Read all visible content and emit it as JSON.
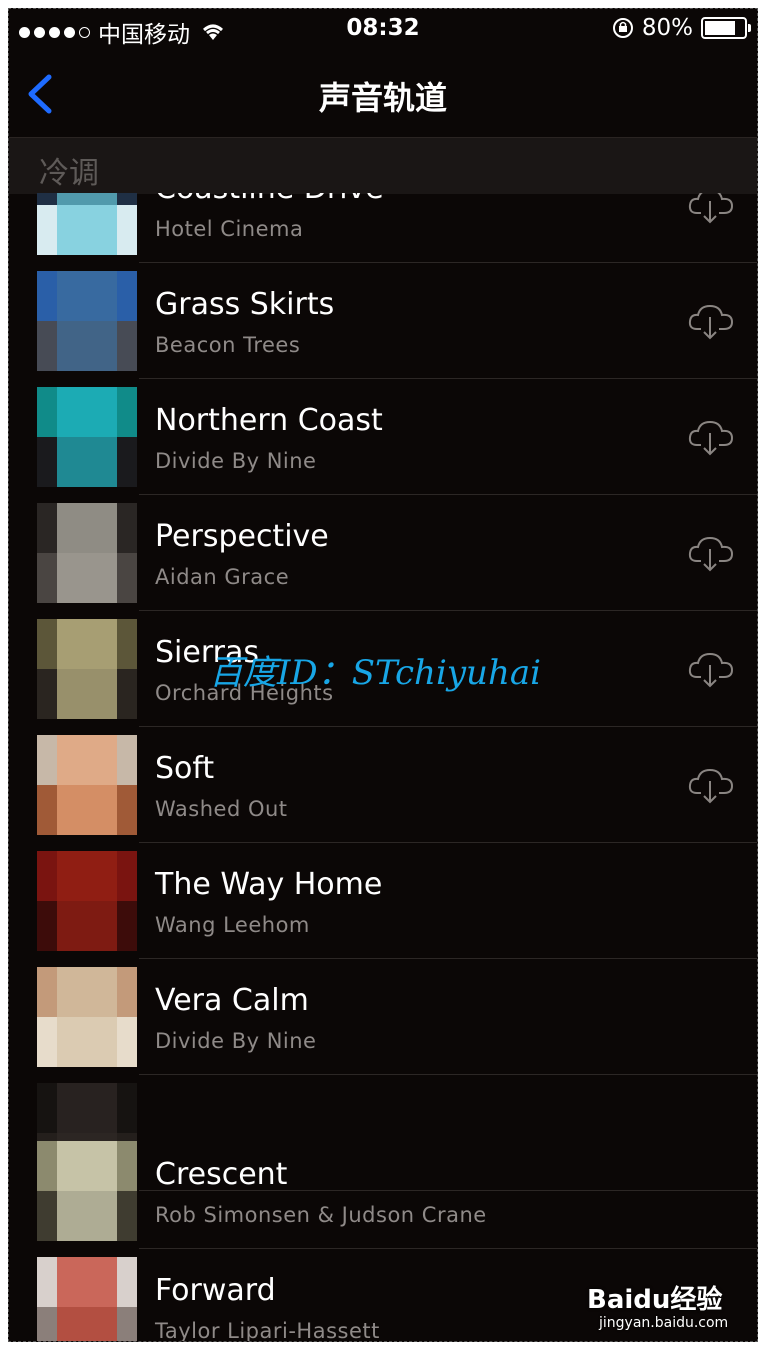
{
  "status_bar": {
    "carrier": "中国移动",
    "time": "08:32",
    "battery": "80%",
    "battery_level": 0.8
  },
  "nav": {
    "title": "声音轨道",
    "back_icon": "chevron-left-icon",
    "accent": "#1e6bff"
  },
  "section": {
    "label": "冷调"
  },
  "tracks": [
    {
      "title": "Coastline Drive",
      "artist": "Hotel Cinema",
      "downloadable": true,
      "art": [
        "#1f2f44",
        "#d8ebf0",
        "#66c7d8"
      ]
    },
    {
      "title": "Grass Skirts",
      "artist": "Beacon Trees",
      "downloadable": true,
      "art": [
        "#2a5fa8",
        "#474b55",
        "#3f6f9c"
      ]
    },
    {
      "title": "Northern Coast",
      "artist": "Divide By Nine",
      "downloadable": true,
      "art": [
        "#108b89",
        "#1a1a1d",
        "#22b9c6"
      ]
    },
    {
      "title": "Perspective",
      "artist": "Aidan Grace",
      "downloadable": true,
      "art": [
        "#2a2624",
        "#4a4542",
        "#bab8ae"
      ]
    },
    {
      "title": "Sierras",
      "artist": "Orchard Heights",
      "downloadable": true,
      "art": [
        "#5c5639",
        "#2a2520",
        "#c7bd8c"
      ]
    },
    {
      "title": "Soft",
      "artist": "Washed Out",
      "downloadable": true,
      "art": [
        "#c7b8a8",
        "#a05a37",
        "#e9a479"
      ]
    },
    {
      "title": "The Way Home",
      "artist": "Wang Leehom",
      "downloadable": false,
      "art": [
        "#7a1410",
        "#3d0c0a",
        "#9a2216"
      ]
    },
    {
      "title": "Vera Calm",
      "artist": "Divide By Nine",
      "downloadable": false,
      "art": [
        "#c39a7a",
        "#e7dccb",
        "#d5c3a6"
      ]
    },
    {
      "title": "",
      "artist": "",
      "downloadable": false,
      "art": [
        "#161311",
        "#241f1c",
        "#302a26"
      ]
    },
    {
      "title": "Crescent",
      "artist": "Rob Simonsen & Judson Crane",
      "downloadable": false,
      "art": [
        "#8c8a6e",
        "#3f3c30",
        "#dedbbf"
      ]
    },
    {
      "title": "Forward",
      "artist": "Taylor Lipari-Hassett",
      "downloadable": false,
      "art": [
        "#d8d0cc",
        "#8b7f7a",
        "#c43a2a"
      ]
    }
  ],
  "watermark": "百度ID：STchiyuhai",
  "baidu_logo": "Baidu经验",
  "baidu_url": "jingyan.baidu.com"
}
